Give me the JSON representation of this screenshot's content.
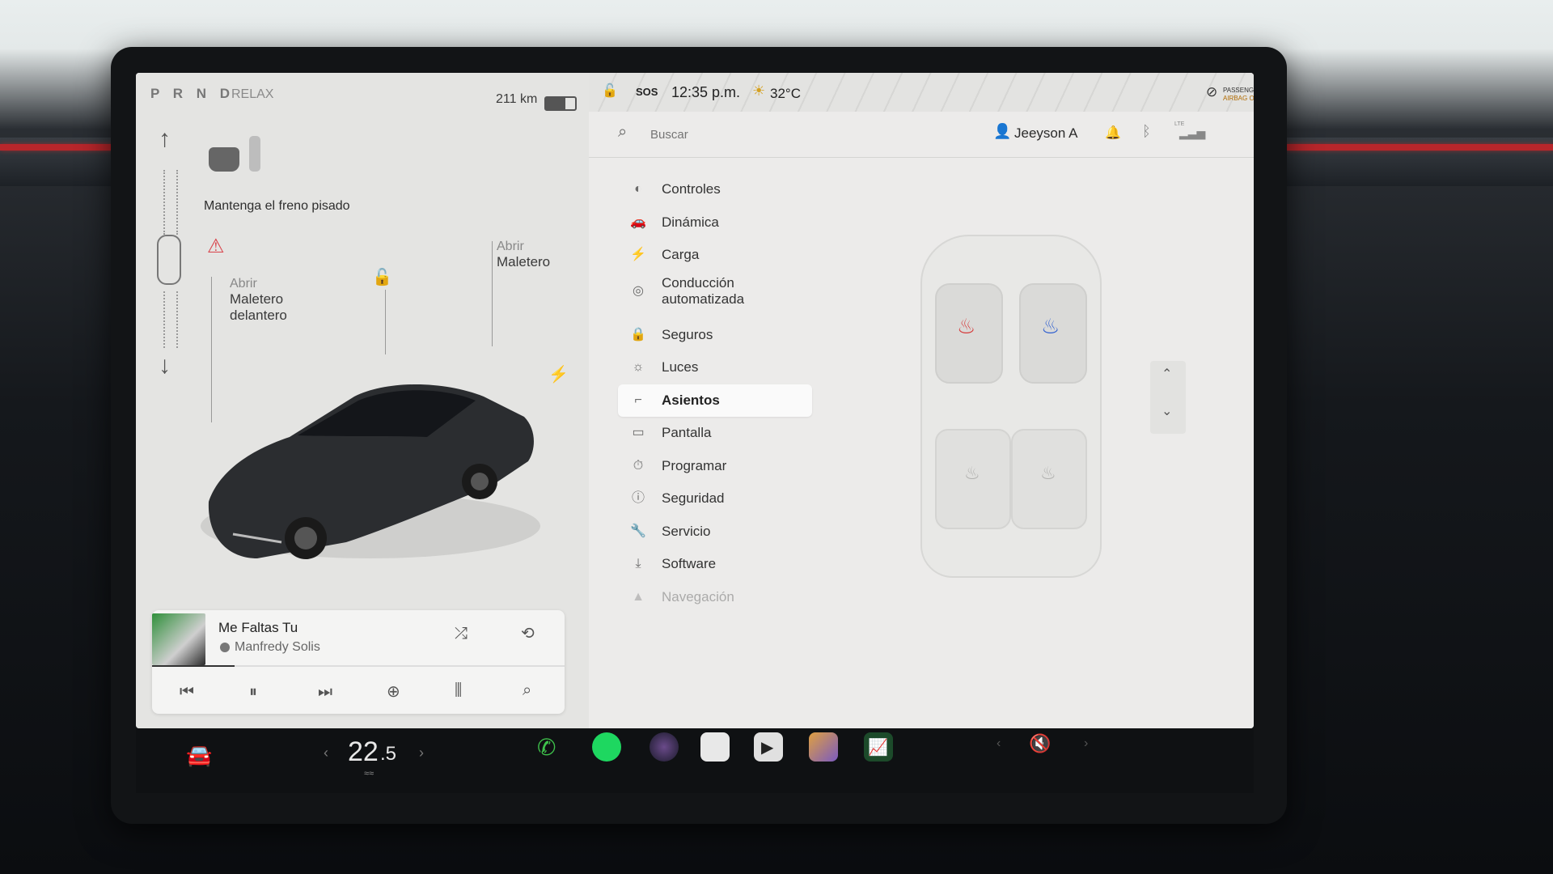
{
  "status": {
    "gears": "P R N D",
    "drive_mode": "RELAX",
    "range": "211 km",
    "sos": "SOS",
    "time": "12:35 p.m.",
    "temperature": "32°C",
    "airbag_line1": "PASSENGER",
    "airbag_line2": "AIRBAG ON",
    "lte": "LTE"
  },
  "left": {
    "brake_message": "Mantenga el freno pisado",
    "frunk_label_1": "Abrir",
    "frunk_label_2": "Maletero",
    "frunk_label_3": "delantero",
    "trunk_label_1": "Abrir",
    "trunk_label_2": "Maletero"
  },
  "media": {
    "title": "Me Faltas Tu",
    "artist": "Manfredy Solis",
    "progress": 0.2
  },
  "search": {
    "placeholder": "Buscar"
  },
  "profile": {
    "name": "Jeeyson A"
  },
  "menu": {
    "items": [
      {
        "label": "Controles",
        "icon": "toggle-icon"
      },
      {
        "label": "Dinámica",
        "icon": "car-icon"
      },
      {
        "label": "Carga",
        "icon": "bolt-icon"
      },
      {
        "label": "Conducción automatizada",
        "icon": "steering-wheel-icon"
      },
      {
        "label": "Seguros",
        "icon": "lock-icon"
      },
      {
        "label": "Luces",
        "icon": "light-icon"
      },
      {
        "label": "Asientos",
        "icon": "seat-icon",
        "active": true
      },
      {
        "label": "Pantalla",
        "icon": "display-icon"
      },
      {
        "label": "Programar",
        "icon": "schedule-icon"
      },
      {
        "label": "Seguridad",
        "icon": "alert-icon"
      },
      {
        "label": "Servicio",
        "icon": "wrench-icon"
      },
      {
        "label": "Software",
        "icon": "download-icon"
      },
      {
        "label": "Navegación",
        "icon": "navigation-icon"
      }
    ]
  },
  "climate": {
    "temp_whole": "22",
    "temp_decimal": ".5"
  },
  "colors": {
    "heat_red": "#d63a3a",
    "heat_blue": "#2f5fd0",
    "seatbelt_red": "#d9434b",
    "accent_strip": "#b8262b"
  }
}
